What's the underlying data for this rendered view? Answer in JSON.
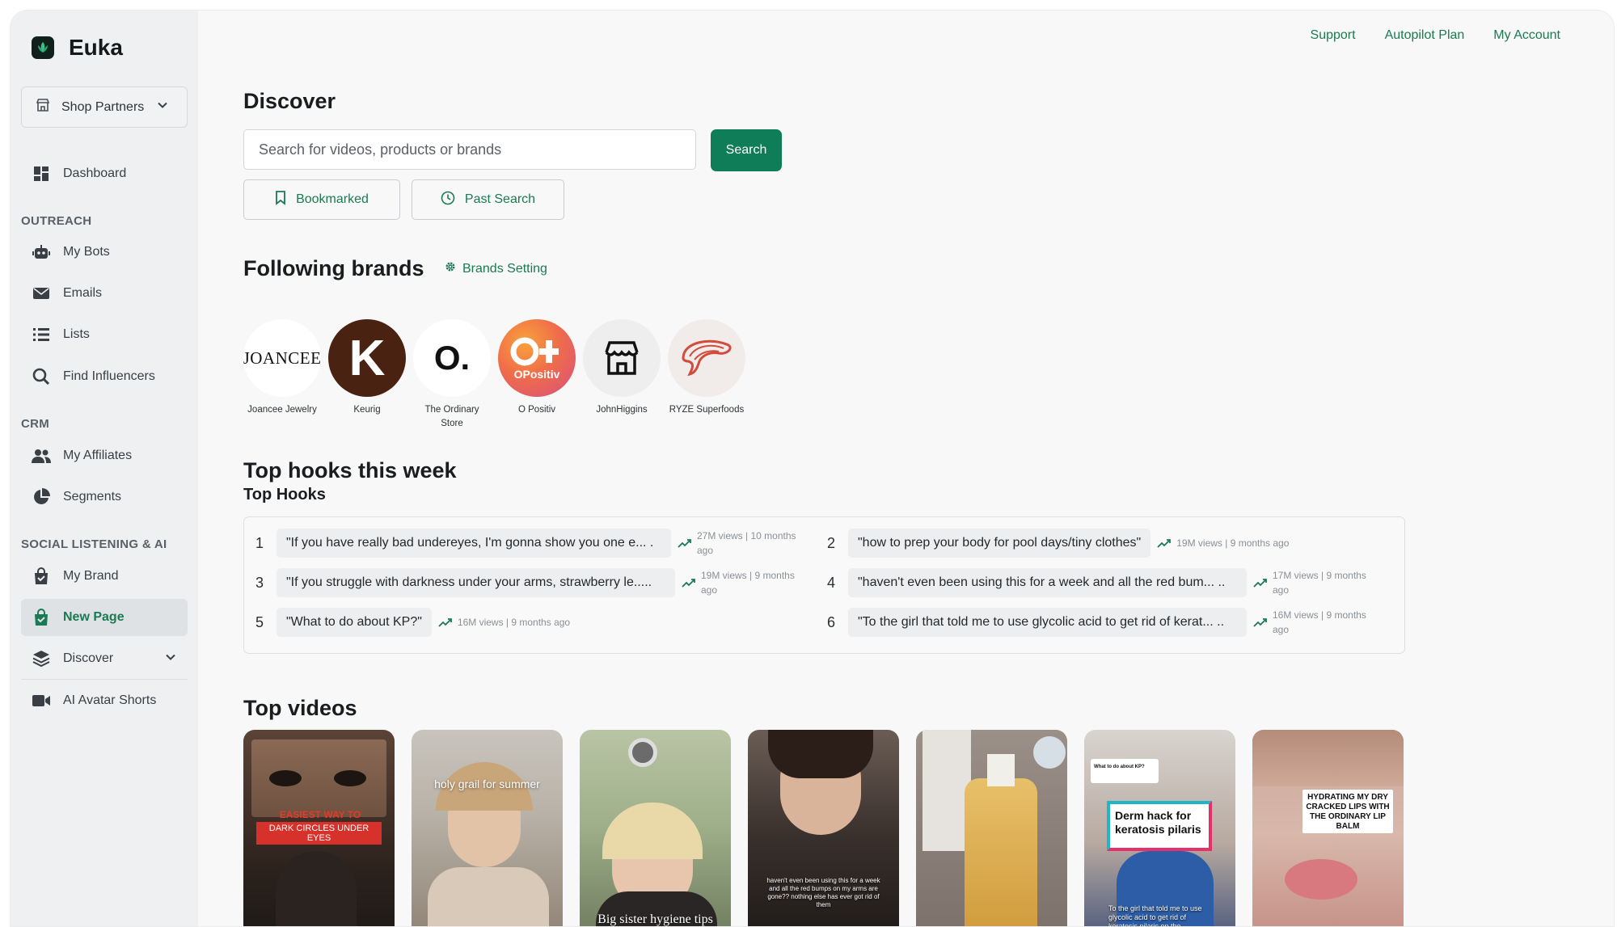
{
  "app": {
    "name": "Euka"
  },
  "sidebar": {
    "shop_select": "Shop Partners",
    "dashboard": "Dashboard",
    "sections": {
      "outreach": "OUTREACH",
      "crm": "CRM",
      "social": "SOCIAL LISTENING & AI"
    },
    "items": {
      "my_bots": "My Bots",
      "emails": "Emails",
      "lists": "Lists",
      "find_influencers": "Find Influencers",
      "my_affiliates": "My Affiliates",
      "segments": "Segments",
      "my_brand": "My Brand",
      "new_page": "New Page",
      "discover": "Discover",
      "ai_avatar_shorts": "AI Avatar Shorts"
    }
  },
  "toplinks": {
    "support": "Support",
    "autopilot": "Autopilot Plan",
    "account": "My Account"
  },
  "discover": {
    "title": "Discover",
    "search_placeholder": "Search for videos, products or brands",
    "search_button": "Search",
    "bookmarked": "Bookmarked",
    "past_search": "Past Search"
  },
  "following": {
    "title": "Following brands",
    "setting": "Brands Setting",
    "brands": [
      {
        "name": "Joancee Jewelry",
        "logo_text": "JOANCEE"
      },
      {
        "name": "Keurig",
        "logo_text": "K"
      },
      {
        "name": "The Ordinary Store",
        "logo_text": "O."
      },
      {
        "name": "O Positiv",
        "logo_text": "OPositiv"
      },
      {
        "name": "JohnHiggins",
        "logo_text": ""
      },
      {
        "name": "RYZE Superfoods",
        "logo_text": ""
      }
    ]
  },
  "hooks": {
    "title": "Top hooks this week",
    "subtitle": "Top Hooks",
    "items": [
      {
        "rank": "1",
        "text": "\"If you have really bad undereyes, I'm gonna show you one e... .",
        "views": "27M views | 10 months ago"
      },
      {
        "rank": "2",
        "text": "\"how to prep your body for pool days/tiny clothes\"",
        "views": "19M views | 9 months ago"
      },
      {
        "rank": "3",
        "text": "\"If you struggle with darkness under your arms, strawberry le.....",
        "views": "19M views | 9 months ago"
      },
      {
        "rank": "4",
        "text": "\"haven't even been using this for a week and all the red bum... ..",
        "views": "17M views | 9 months ago"
      },
      {
        "rank": "5",
        "text": "\"What to do about KP?\"",
        "views": "16M views | 9 months ago"
      },
      {
        "rank": "6",
        "text": "\"To the girl that told me to use glycolic acid to get rid of kerat... ..",
        "views": "16M views | 9 months ago"
      }
    ]
  },
  "videos": {
    "title": "Top videos",
    "items": [
      {
        "caption": "EASIEST WAY TO REDUCE",
        "caption2": "DARK CIRCLES UNDER EYES"
      },
      {
        "caption": "holy grail for summer"
      },
      {
        "caption": "Big sister hygiene tips"
      },
      {
        "caption": "haven't even been using this for a week and all the red bumps on my arms are gone?? nothing else has ever got rid of them"
      },
      {
        "caption": ""
      },
      {
        "caption": "Derm hack for keratosis pilaris",
        "caption2": "To the girl that told me to use glycolic acid to get rid of keratosis pilaris on the",
        "reply": "What to do about KP?"
      },
      {
        "caption": "HYDRATING MY DRY CRACKED LIPS WITH THE ORDINARY LIP BALM"
      }
    ]
  },
  "colors": {
    "accent": "#0f7d57",
    "sidebar_bg": "#eef0f2",
    "page_bg": "#f8f8f8"
  }
}
